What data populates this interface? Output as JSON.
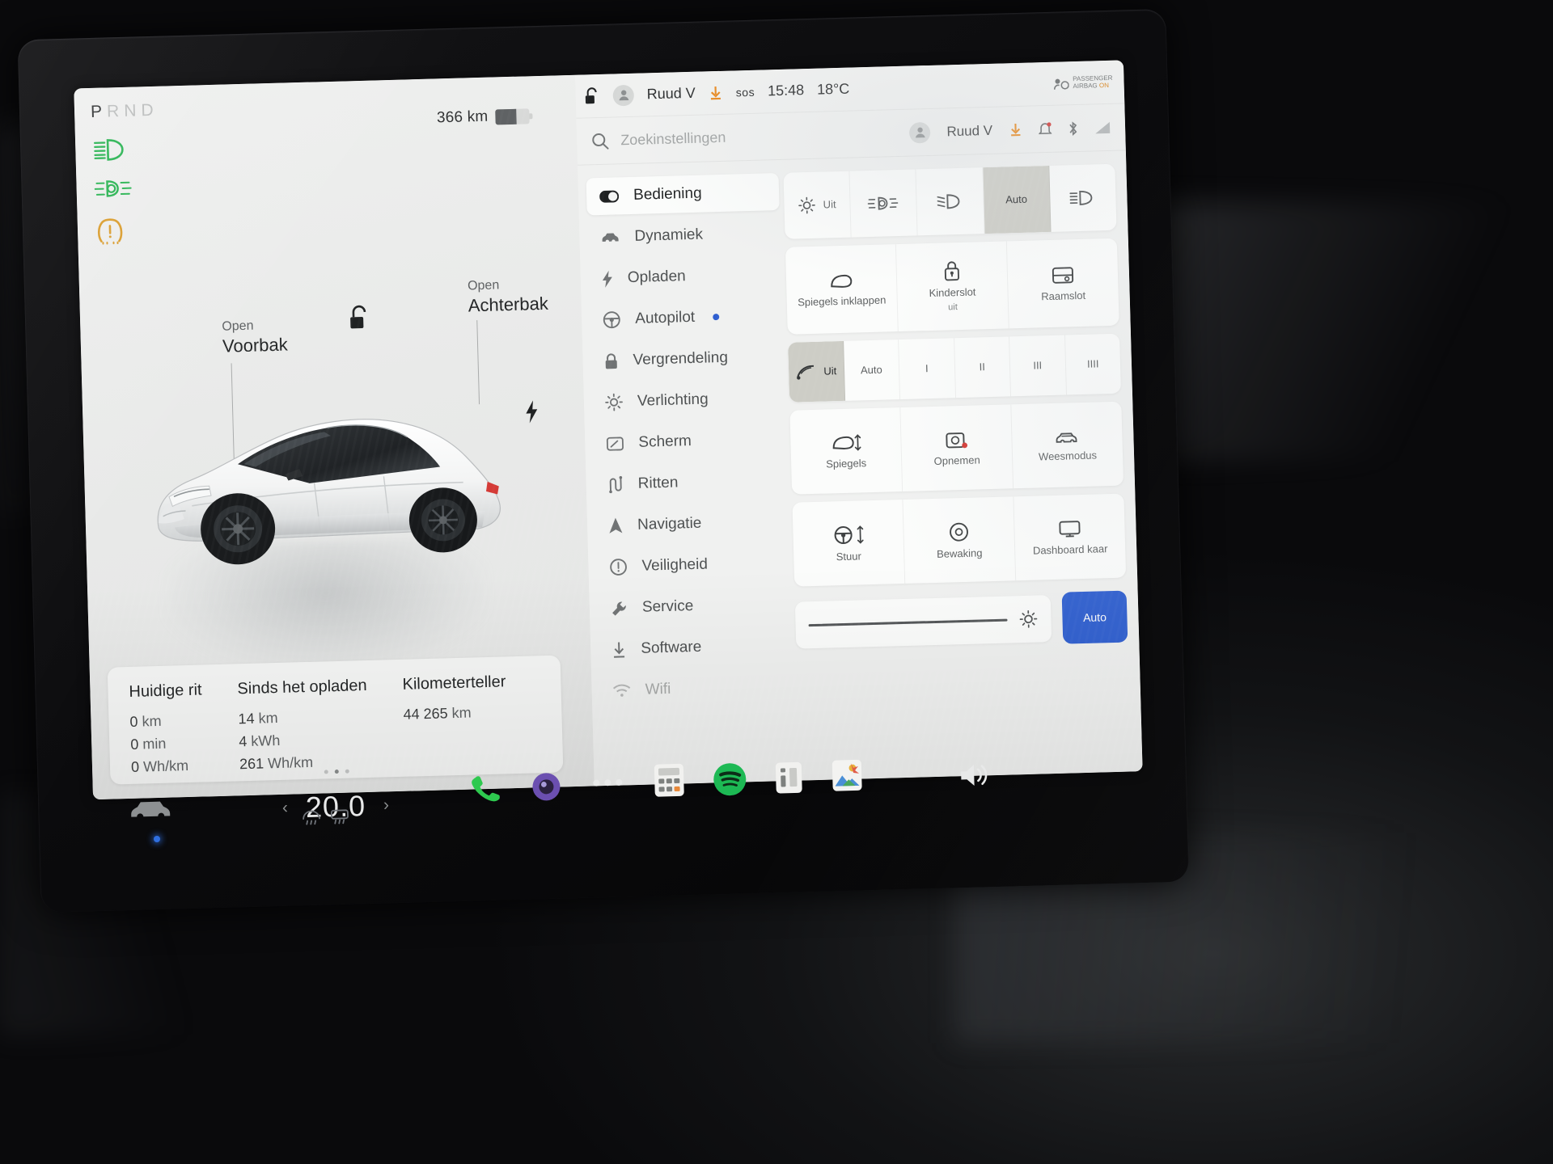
{
  "vehicle_display": {
    "gear": {
      "options": [
        "P",
        "R",
        "N",
        "D"
      ],
      "active": "P"
    },
    "telltales": [
      {
        "name": "high-beam-icon",
        "color": "#22b14c"
      },
      {
        "name": "fog-light-icon",
        "color": "#22b14c"
      },
      {
        "name": "tpms-warning-icon",
        "color": "#d99a28"
      }
    ],
    "range": "366 km",
    "battery_percent": 62,
    "callouts": {
      "front": {
        "action": "Open",
        "target": "Voorbak"
      },
      "rear": {
        "action": "Open",
        "target": "Achterbak"
      }
    },
    "icons": [
      "unlock-icon",
      "charge-bolt-icon"
    ],
    "trip_card": {
      "current_trip": {
        "title": "Huidige rit",
        "lines": [
          {
            "value": "0",
            "unit": "km"
          },
          {
            "value": "0",
            "unit": "min"
          },
          {
            "value": "0",
            "unit": "Wh/km"
          }
        ]
      },
      "since_charge": {
        "title": "Sinds het opladen",
        "lines": [
          {
            "value": "14",
            "unit": "km"
          },
          {
            "value": "4",
            "unit": "kWh"
          },
          {
            "value": "261",
            "unit": "Wh/km"
          }
        ]
      },
      "odometer": {
        "title": "Kilometerteller",
        "lines": [
          {
            "value": "44 265",
            "unit": "km"
          }
        ]
      }
    },
    "page_dots": {
      "count": 3,
      "active_index": 1
    }
  },
  "status_bar": {
    "lock_icon": "unlock-icon",
    "profile": "Ruud V",
    "download_icon": "software-download-icon",
    "sos": "sos",
    "time": "15:48",
    "temperature": "18°C",
    "airbag_label_line1": "PASSENGER",
    "airbag_label_line2": "AIRBAG",
    "airbag_status": "ON"
  },
  "settings": {
    "search": {
      "placeholder": "Zoekinstellingen"
    },
    "header_profile": "Ruud V",
    "header_icons": [
      "software-download-icon",
      "bell-icon",
      "bluetooth-icon",
      "signal-icon"
    ],
    "sidebar": [
      {
        "label": "Bediening",
        "icon": "toggle-icon",
        "selected": true
      },
      {
        "label": "Dynamiek",
        "icon": "car-icon",
        "selected": false
      },
      {
        "label": "Opladen",
        "icon": "bolt-icon",
        "selected": false
      },
      {
        "label": "Autopilot",
        "icon": "steering-wheel-icon",
        "selected": false,
        "badge": true
      },
      {
        "label": "Vergrendeling",
        "icon": "lock-icon",
        "selected": false
      },
      {
        "label": "Verlichting",
        "icon": "sun-icon",
        "selected": false
      },
      {
        "label": "Scherm",
        "icon": "display-icon",
        "selected": false
      },
      {
        "label": "Ritten",
        "icon": "trips-icon",
        "selected": false
      },
      {
        "label": "Navigatie",
        "icon": "navigation-arrow-icon",
        "selected": false
      },
      {
        "label": "Veiligheid",
        "icon": "warning-circle-icon",
        "selected": false
      },
      {
        "label": "Service",
        "icon": "wrench-icon",
        "selected": false
      },
      {
        "label": "Software",
        "icon": "download-icon",
        "selected": false
      },
      {
        "label": "Wifi",
        "icon": "wifi-icon",
        "selected": false
      }
    ],
    "lights_row": [
      {
        "label": "Uit",
        "icon": "headlight-off-icon",
        "active": false
      },
      {
        "label": "",
        "icon": "fog-light-icon",
        "active": false
      },
      {
        "label": "",
        "icon": "low-beam-icon",
        "active": false
      },
      {
        "label": "Auto",
        "icon": "",
        "active": true
      },
      {
        "label": "",
        "icon": "high-beam-icon",
        "active": false
      }
    ],
    "tiles_row_1": [
      {
        "label": "Spiegels inklappen",
        "icon": "mirror-icon",
        "sub": ""
      },
      {
        "label": "Kinderslot",
        "icon": "child-lock-icon",
        "sub": "uit"
      },
      {
        "label": "Raamslot",
        "icon": "window-lock-icon",
        "sub": ""
      }
    ],
    "wiper_row": [
      {
        "label": "Uit",
        "icon": "wiper-icon",
        "active": true
      },
      {
        "label": "Auto",
        "icon": "",
        "active": false
      },
      {
        "label": "I",
        "icon": "",
        "active": false
      },
      {
        "label": "II",
        "icon": "",
        "active": false
      },
      {
        "label": "III",
        "icon": "",
        "active": false
      },
      {
        "label": "IIII",
        "icon": "",
        "active": false
      }
    ],
    "tiles_row_2": [
      {
        "label": "Spiegels",
        "icon": "mirror-adjust-icon"
      },
      {
        "label": "Opnemen",
        "icon": "dashcam-record-icon"
      },
      {
        "label": "Weesmodus",
        "icon": "sentry-car-icon"
      },
      {
        "label": "Stuur",
        "icon": "steering-adjust-icon"
      },
      {
        "label": "Bewaking",
        "icon": "sentry-mode-icon"
      },
      {
        "label": "Dashboard kaar",
        "icon": "dashboard-display-icon"
      }
    ],
    "brightness": {
      "icon": "brightness-icon",
      "value_percent": 72
    },
    "auto_button": {
      "label": "Auto",
      "color": "#2f5fd0"
    }
  },
  "dock": {
    "temperature": "20.0",
    "items": [
      {
        "name": "phone-icon",
        "color": "#2ec94f"
      },
      {
        "name": "camera-icon",
        "color": "#6b4fb0"
      },
      {
        "name": "more-dots-icon",
        "color": "#e8e9e9"
      },
      {
        "name": "calculator-app-icon",
        "color": "#f3f3f1"
      },
      {
        "name": "spotify-icon",
        "color": "#1db954"
      },
      {
        "name": "info-app-icon",
        "color": "#f3f3f1"
      },
      {
        "name": "photos-app-icon",
        "color": "#e8893a"
      },
      {
        "name": "volume-icon",
        "color": "#e8e9e9"
      }
    ],
    "car_button": "car-icon",
    "defrost": [
      "front-defrost-icon",
      "rear-defrost-icon"
    ]
  }
}
